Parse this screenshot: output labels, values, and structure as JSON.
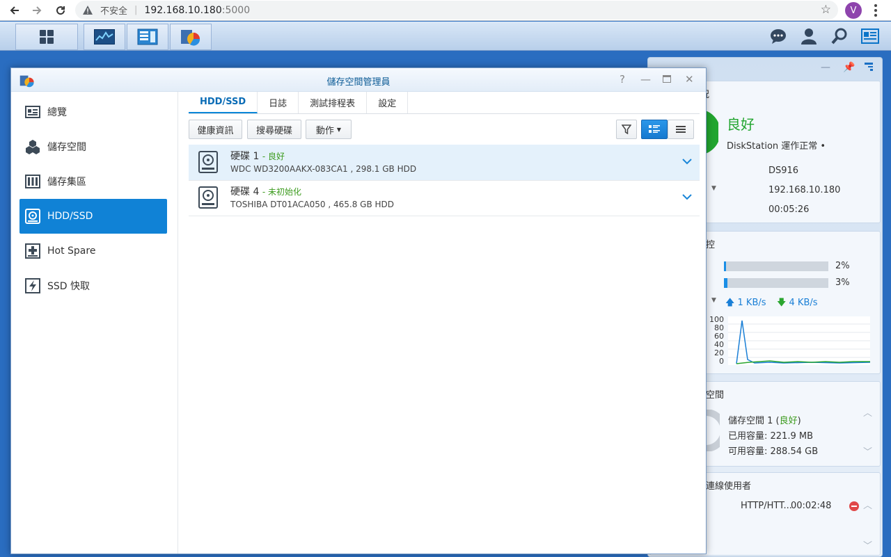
{
  "browser": {
    "insecure_label": "不安全",
    "url_host": "192.168.10.180",
    "url_port": ":5000",
    "profile_initial": "V"
  },
  "widgets": {
    "system_health": {
      "title_partial": "況",
      "status": "良好",
      "status_detail": "DiskStation 運作正常 •",
      "model": "DS916",
      "ip": "192.168.10.180",
      "uptime": "00:05:26",
      "status_color": "#22a52f"
    },
    "resource_monitor": {
      "title_partial": "控",
      "cpu_percent_label": "2%",
      "ram_percent_label": "3%",
      "cpu_level": 0.02,
      "ram_level": 0.03,
      "upload": "1 KB/s",
      "download": "4 KB/s",
      "y_ticks": [
        "100",
        "80",
        "60",
        "40",
        "20",
        "0"
      ]
    },
    "storage": {
      "title_partial": "空間",
      "volume_name": "儲存空間 1",
      "volume_status": "良好",
      "used": "已用容量: 221.9 MB",
      "available": "可用容量: 288.54 GB"
    },
    "connected_users": {
      "title_partial": "連線使用者",
      "session": "HTTP/HTT...",
      "time": "00:02:48"
    }
  },
  "window": {
    "title": "儲存空間管理員",
    "help": "?",
    "sidebar": [
      {
        "label": "總覽",
        "icon": "overview-icon"
      },
      {
        "label": "儲存空間",
        "icon": "volume-icon"
      },
      {
        "label": "儲存集區",
        "icon": "storage-pool-icon"
      },
      {
        "label": "HDD/SSD",
        "icon": "hdd-icon"
      },
      {
        "label": "Hot Spare",
        "icon": "hot-spare-icon"
      },
      {
        "label": "SSD 快取",
        "icon": "ssd-cache-icon"
      }
    ],
    "active_sidebar": "HDD/SSD",
    "tabs": [
      "HDD/SSD",
      "日誌",
      "測試排程表",
      "設定"
    ],
    "toolbar": {
      "health_info": "健康資訊",
      "find_disk": "搜尋硬碟",
      "action": "動作"
    },
    "disks": [
      {
        "name": "硬碟 1",
        "status": "良好",
        "detail": "WDC WD3200AAKX-083CA1 , 298.1 GB HDD"
      },
      {
        "name": "硬碟 4",
        "status": "未初始化",
        "detail": "TOSHIBA DT01ACA050 , 465.8 GB HDD"
      }
    ]
  },
  "colors": {
    "accent": "#1082d6",
    "good_green": "#3c9b1e",
    "desktop": "#2a6dc0"
  }
}
